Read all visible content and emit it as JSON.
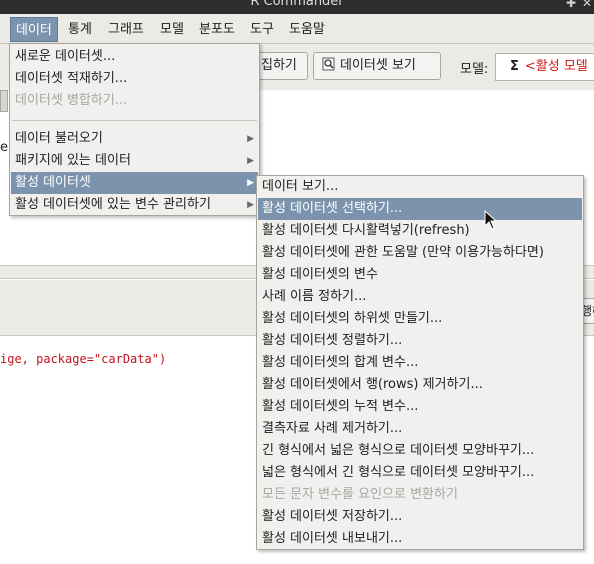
{
  "window": {
    "title": "R Commander",
    "buttons": [
      "✚",
      "✕"
    ]
  },
  "menubar": {
    "items": [
      {
        "label": "데이터",
        "active": true
      },
      {
        "label": "통계"
      },
      {
        "label": "그래프"
      },
      {
        "label": "모델"
      },
      {
        "label": "분포도"
      },
      {
        "label": "도구"
      },
      {
        "label": "도움말"
      }
    ]
  },
  "toolbar": {
    "edit_label": "집하기",
    "view_label": "데이터셋 보기",
    "model_label": "모델:",
    "model_sigma": "Σ",
    "model_value": "<활성 모델"
  },
  "script": {
    "fragment": "e,"
  },
  "submit": {
    "label": "행하"
  },
  "output": {
    "line": "ige, package=\"carData\")"
  },
  "data_menu": {
    "items": [
      {
        "label": "새로운 데이터셋..."
      },
      {
        "label": "데이터셋 적재하기..."
      },
      {
        "label": "데이터셋 병합하기...",
        "disabled": true
      },
      {
        "label": "데이터 불러오기",
        "submenu": true
      },
      {
        "label": "패키지에 있는 데이터",
        "submenu": true
      },
      {
        "label": "활성 데이터셋",
        "submenu": true,
        "highlighted": true
      },
      {
        "label": "활성 데이터셋에 있는 변수 관리하기",
        "submenu": true
      }
    ],
    "arrow": "▶"
  },
  "active_dataset_menu": {
    "items": [
      {
        "label": "데이터 보기..."
      },
      {
        "label": "활성 데이터셋 선택하기...",
        "highlighted": true
      },
      {
        "label": "활성 데이터셋 다시활력넣기(refresh)"
      },
      {
        "label": "활성 데이터셋에 관한 도움말 (만약 이용가능하다면)"
      },
      {
        "label": "활성 데이터셋의 변수"
      },
      {
        "label": "사례 이름 정하기..."
      },
      {
        "label": "활성 데이터셋의 하위셋 만들기..."
      },
      {
        "label": "활성 데이터셋 정렬하기..."
      },
      {
        "label": "활성 데이터셋의 합계 변수..."
      },
      {
        "label": "활성 데이터셋에서 행(rows) 제거하기..."
      },
      {
        "label": "활성 데이터셋의 누적 변수..."
      },
      {
        "label": "결측자료 사례 제거하기..."
      },
      {
        "label": "긴 형식에서 넓은 형식으로 데이터셋 모양바꾸기..."
      },
      {
        "label": "넓은 형식에서 긴 형식으로 데이터셋 모양바꾸기..."
      },
      {
        "label": "모든 문자 변수를 요인으로 변환하기",
        "disabled": true
      },
      {
        "label": "활성 데이터셋 저장하기..."
      },
      {
        "label": "활성 데이터셋 내보내기..."
      }
    ]
  }
}
